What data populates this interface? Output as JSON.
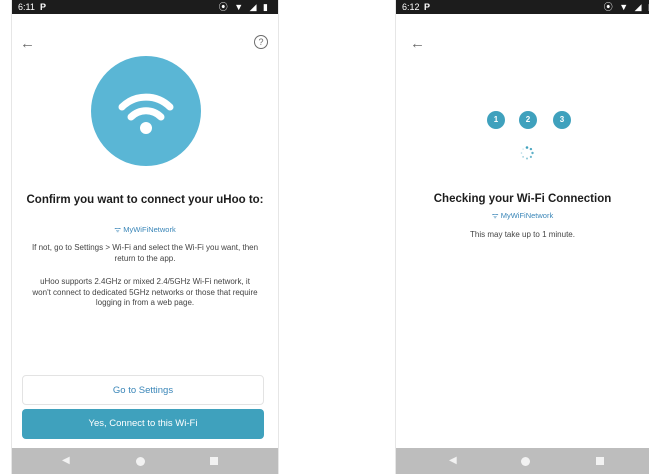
{
  "left_screen": {
    "status_time": "6:11",
    "status_app_icon": "P",
    "status_icons": "⦿ ▼ ◢ ▮",
    "back_icon": "←",
    "help_icon": "?",
    "wifi_icon": "wifi-icon",
    "title": "Confirm you want to connect your uHoo to:",
    "network_name": "ᯤ MyWiFiNetwork",
    "instruction": "If not, go to Settings > Wi-Fi and select the Wi-Fi you want, then return to the app.",
    "support_note": "uHoo supports 2.4GHz or mixed 2.4/5GHz Wi-Fi network, it won't connect to dedicated 5GHz networks or those that require logging in from a web page.",
    "button_settings": "Go to Settings",
    "button_connect": "Yes, Connect to this Wi-Fi"
  },
  "right_screen": {
    "status_time": "6:12",
    "status_app_icon": "P",
    "status_icons": "⦿ ▼ ◢ ▮",
    "back_icon": "←",
    "steps": [
      "1",
      "2",
      "3"
    ],
    "title": "Checking your Wi-Fi Connection",
    "network_name": "ᯤ MyWiFiNetwork",
    "wait_text": "This may take up to 1 minute."
  },
  "navbar": {
    "back": "◀"
  },
  "colors": {
    "accent": "#3fa1bd",
    "wifi_circle": "#5ab6d5",
    "link": "#3a86b8"
  }
}
